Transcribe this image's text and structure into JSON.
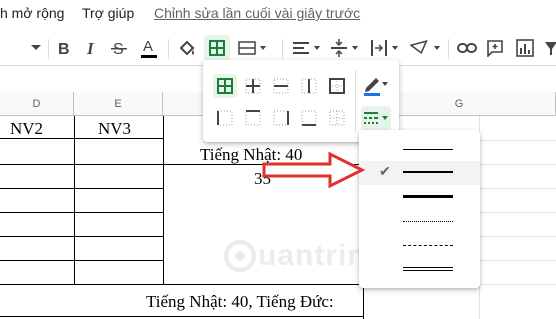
{
  "menu": {
    "items": [
      "h mở rộng",
      "Trợ giúp"
    ],
    "last_edit": "Chỉnh sửa lần cuối vài giây trước"
  },
  "toolbar": {
    "buttons": [
      "chevron-down-icon",
      "bold-icon",
      "italic-icon",
      "strikethrough-icon",
      "text-color-icon",
      "fill-color-icon",
      "borders-icon",
      "merge-cells-icon",
      "align-horizontal-icon",
      "align-vertical-icon",
      "text-wrap-icon",
      "text-rotation-icon",
      "link-icon",
      "comment-icon",
      "chart-icon"
    ],
    "text_color_swatch": "#000000",
    "active_accent": "#188038"
  },
  "grid": {
    "columns": [
      "D",
      "E",
      "G"
    ],
    "cells": {
      "d1": "NV2",
      "e1": "NV3",
      "merged_row2": "Tiếng Nhật: 40",
      "merged_row3": "35",
      "bottom_row": "Tiếng Nhật: 40, Tiếng Đức:"
    }
  },
  "border_popup": {
    "row1": [
      "all-borders-icon",
      "inner-borders-icon",
      "horizontal-borders-icon",
      "vertical-borders-icon",
      "outer-borders-icon"
    ],
    "row2": [
      "left-border-icon",
      "top-border-icon",
      "right-border-icon",
      "bottom-border-icon",
      "clear-borders-icon"
    ],
    "border_color_underline": "#1a73e8"
  },
  "line_style_menu": {
    "options": [
      "thin-solid",
      "medium-solid",
      "thick-solid",
      "dotted",
      "dashed",
      "double"
    ],
    "selected_index": 1
  },
  "watermark": {
    "text": "uantrimang"
  },
  "colors": {
    "arrow_red": "#e0312a",
    "grid_line": "#e2e2e2"
  }
}
